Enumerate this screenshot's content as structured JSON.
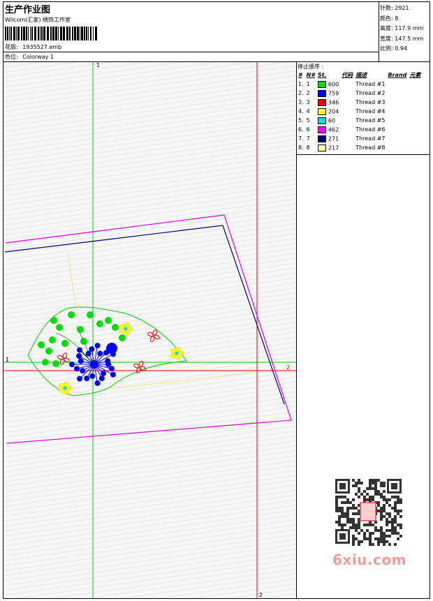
{
  "header": {
    "title": "生产作业图",
    "company": "Wilcom(汇家) 绣饰工作室",
    "design_label": "花版:",
    "design_file": "1935527.emb",
    "colorway_label": "色位:",
    "colorway": "Colorway 1"
  },
  "stats": {
    "stitches_label": "针数:",
    "stitches": "2921",
    "colors_label": "颜色:",
    "colors": "8",
    "height_label": "高度:",
    "height": "117.9 mm",
    "width_label": "宽度:",
    "width": "147.5 mm",
    "scale_label": "比例:",
    "scale": "0.94"
  },
  "sequence": {
    "header": "停止顺序 :",
    "columns": [
      "#",
      "N#",
      "St.",
      "代码",
      "描述",
      "Brand",
      "元素"
    ],
    "rows": [
      {
        "n": "1.",
        "c": "1",
        "code": "600",
        "desc": "Thread #1",
        "color": "#00e000"
      },
      {
        "n": "2.",
        "c": "2",
        "code": "759",
        "desc": "Thread #2",
        "color": "#0000ff"
      },
      {
        "n": "3.",
        "c": "3",
        "code": "346",
        "desc": "Thread #3",
        "color": "#ff0000"
      },
      {
        "n": "4.",
        "c": "4",
        "code": "204",
        "desc": "Thread #4",
        "color": "#ffff00"
      },
      {
        "n": "5.",
        "c": "5",
        "code": "60",
        "desc": "Thread #5",
        "color": "#00e0e0"
      },
      {
        "n": "6.",
        "c": "6",
        "code": "462",
        "desc": "Thread #6",
        "color": "#ff00ff"
      },
      {
        "n": "7.",
        "c": "7",
        "code": "271",
        "desc": "Thread #7",
        "color": "#000080"
      },
      {
        "n": "8.",
        "c": "8",
        "code": "217",
        "desc": "Thread #8",
        "color": "#ffff99"
      }
    ]
  },
  "axes": {
    "v1": "1",
    "h1": "1",
    "h2": "2",
    "v2": "2"
  },
  "watermark": "6xiu.com"
}
